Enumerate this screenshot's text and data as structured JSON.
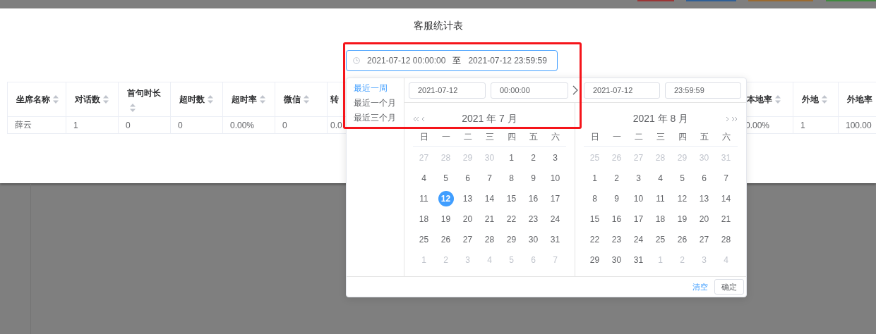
{
  "background_buttons": [
    {
      "color": "#9b3535"
    },
    {
      "color": "#2f5f96"
    },
    {
      "color": "#9a6a30"
    },
    {
      "color": "#3f8a3f"
    }
  ],
  "title": "客服统计表",
  "date_range": {
    "start": "2021-07-12 00:00:00",
    "separator": "至",
    "end": "2021-07-12 23:59:59"
  },
  "table": {
    "left_columns": [
      {
        "label": "坐席名称",
        "sortable": true
      },
      {
        "label": "对话数",
        "sortable": true
      },
      {
        "label": "首句时长",
        "sortable": true
      },
      {
        "label": "超时数",
        "sortable": true
      },
      {
        "label": "超时率",
        "sortable": true
      },
      {
        "label": "微信",
        "sortable": true
      },
      {
        "label": "转",
        "sortable": false
      }
    ],
    "right_columns": [
      {
        "label": "本地率",
        "sortable": true
      },
      {
        "label": "外地",
        "sortable": true
      },
      {
        "label": "外地率",
        "sortable": false
      }
    ],
    "rows": [
      {
        "left_cells": [
          "薛云",
          "1",
          "0",
          "0",
          "0.00%",
          "0",
          "0.0"
        ],
        "right_cells": [
          "0.00%",
          "1",
          "100.00"
        ]
      }
    ]
  },
  "picker": {
    "shortcuts": [
      {
        "label": "最近一周",
        "selected": true
      },
      {
        "label": "最近一个月",
        "selected": false
      },
      {
        "label": "最近三个月",
        "selected": false
      }
    ],
    "start_date": "2021-07-12",
    "start_time": "00:00:00",
    "end_date": "2021-07-12",
    "end_time": "23:59:59",
    "months": [
      {
        "title": "2021 年 7 月",
        "weekdays": [
          "日",
          "一",
          "二",
          "三",
          "四",
          "五",
          "六"
        ],
        "days": [
          {
            "day": "27",
            "in_month": false,
            "selected": false
          },
          {
            "day": "28",
            "in_month": false,
            "selected": false
          },
          {
            "day": "29",
            "in_month": false,
            "selected": false
          },
          {
            "day": "30",
            "in_month": false,
            "selected": false
          },
          {
            "day": "1",
            "in_month": true,
            "selected": false
          },
          {
            "day": "2",
            "in_month": true,
            "selected": false
          },
          {
            "day": "3",
            "in_month": true,
            "selected": false
          },
          {
            "day": "4",
            "in_month": true,
            "selected": false
          },
          {
            "day": "5",
            "in_month": true,
            "selected": false
          },
          {
            "day": "6",
            "in_month": true,
            "selected": false
          },
          {
            "day": "7",
            "in_month": true,
            "selected": false
          },
          {
            "day": "8",
            "in_month": true,
            "selected": false
          },
          {
            "day": "9",
            "in_month": true,
            "selected": false
          },
          {
            "day": "10",
            "in_month": true,
            "selected": false
          },
          {
            "day": "11",
            "in_month": true,
            "selected": false
          },
          {
            "day": "12",
            "in_month": true,
            "selected": true
          },
          {
            "day": "13",
            "in_month": true,
            "selected": false
          },
          {
            "day": "14",
            "in_month": true,
            "selected": false
          },
          {
            "day": "15",
            "in_month": true,
            "selected": false
          },
          {
            "day": "16",
            "in_month": true,
            "selected": false
          },
          {
            "day": "17",
            "in_month": true,
            "selected": false
          },
          {
            "day": "18",
            "in_month": true,
            "selected": false
          },
          {
            "day": "19",
            "in_month": true,
            "selected": false
          },
          {
            "day": "20",
            "in_month": true,
            "selected": false
          },
          {
            "day": "21",
            "in_month": true,
            "selected": false
          },
          {
            "day": "22",
            "in_month": true,
            "selected": false
          },
          {
            "day": "23",
            "in_month": true,
            "selected": false
          },
          {
            "day": "24",
            "in_month": true,
            "selected": false
          },
          {
            "day": "25",
            "in_month": true,
            "selected": false
          },
          {
            "day": "26",
            "in_month": true,
            "selected": false
          },
          {
            "day": "27",
            "in_month": true,
            "selected": false
          },
          {
            "day": "28",
            "in_month": true,
            "selected": false
          },
          {
            "day": "29",
            "in_month": true,
            "selected": false
          },
          {
            "day": "30",
            "in_month": true,
            "selected": false
          },
          {
            "day": "31",
            "in_month": true,
            "selected": false
          },
          {
            "day": "1",
            "in_month": false,
            "selected": false
          },
          {
            "day": "2",
            "in_month": false,
            "selected": false
          },
          {
            "day": "3",
            "in_month": false,
            "selected": false
          },
          {
            "day": "4",
            "in_month": false,
            "selected": false
          },
          {
            "day": "5",
            "in_month": false,
            "selected": false
          },
          {
            "day": "6",
            "in_month": false,
            "selected": false
          },
          {
            "day": "7",
            "in_month": false,
            "selected": false
          }
        ]
      },
      {
        "title": "2021 年 8 月",
        "weekdays": [
          "日",
          "一",
          "二",
          "三",
          "四",
          "五",
          "六"
        ],
        "days": [
          {
            "day": "25",
            "in_month": false,
            "selected": false
          },
          {
            "day": "26",
            "in_month": false,
            "selected": false
          },
          {
            "day": "27",
            "in_month": false,
            "selected": false
          },
          {
            "day": "28",
            "in_month": false,
            "selected": false
          },
          {
            "day": "29",
            "in_month": false,
            "selected": false
          },
          {
            "day": "30",
            "in_month": false,
            "selected": false
          },
          {
            "day": "31",
            "in_month": false,
            "selected": false
          },
          {
            "day": "1",
            "in_month": true,
            "selected": false
          },
          {
            "day": "2",
            "in_month": true,
            "selected": false
          },
          {
            "day": "3",
            "in_month": true,
            "selected": false
          },
          {
            "day": "4",
            "in_month": true,
            "selected": false
          },
          {
            "day": "5",
            "in_month": true,
            "selected": false
          },
          {
            "day": "6",
            "in_month": true,
            "selected": false
          },
          {
            "day": "7",
            "in_month": true,
            "selected": false
          },
          {
            "day": "8",
            "in_month": true,
            "selected": false
          },
          {
            "day": "9",
            "in_month": true,
            "selected": false
          },
          {
            "day": "10",
            "in_month": true,
            "selected": false
          },
          {
            "day": "11",
            "in_month": true,
            "selected": false
          },
          {
            "day": "12",
            "in_month": true,
            "selected": false
          },
          {
            "day": "13",
            "in_month": true,
            "selected": false
          },
          {
            "day": "14",
            "in_month": true,
            "selected": false
          },
          {
            "day": "15",
            "in_month": true,
            "selected": false
          },
          {
            "day": "16",
            "in_month": true,
            "selected": false
          },
          {
            "day": "17",
            "in_month": true,
            "selected": false
          },
          {
            "day": "18",
            "in_month": true,
            "selected": false
          },
          {
            "day": "19",
            "in_month": true,
            "selected": false
          },
          {
            "day": "20",
            "in_month": true,
            "selected": false
          },
          {
            "day": "21",
            "in_month": true,
            "selected": false
          },
          {
            "day": "22",
            "in_month": true,
            "selected": false
          },
          {
            "day": "23",
            "in_month": true,
            "selected": false
          },
          {
            "day": "24",
            "in_month": true,
            "selected": false
          },
          {
            "day": "25",
            "in_month": true,
            "selected": false
          },
          {
            "day": "26",
            "in_month": true,
            "selected": false
          },
          {
            "day": "27",
            "in_month": true,
            "selected": false
          },
          {
            "day": "28",
            "in_month": true,
            "selected": false
          },
          {
            "day": "29",
            "in_month": true,
            "selected": false
          },
          {
            "day": "30",
            "in_month": true,
            "selected": false
          },
          {
            "day": "31",
            "in_month": true,
            "selected": false
          },
          {
            "day": "1",
            "in_month": false,
            "selected": false
          },
          {
            "day": "2",
            "in_month": false,
            "selected": false
          },
          {
            "day": "3",
            "in_month": false,
            "selected": false
          },
          {
            "day": "4",
            "in_month": false,
            "selected": false
          }
        ]
      }
    ],
    "clear": "清空",
    "confirm": "确定"
  },
  "annotation": {
    "kind": "rectangle"
  }
}
